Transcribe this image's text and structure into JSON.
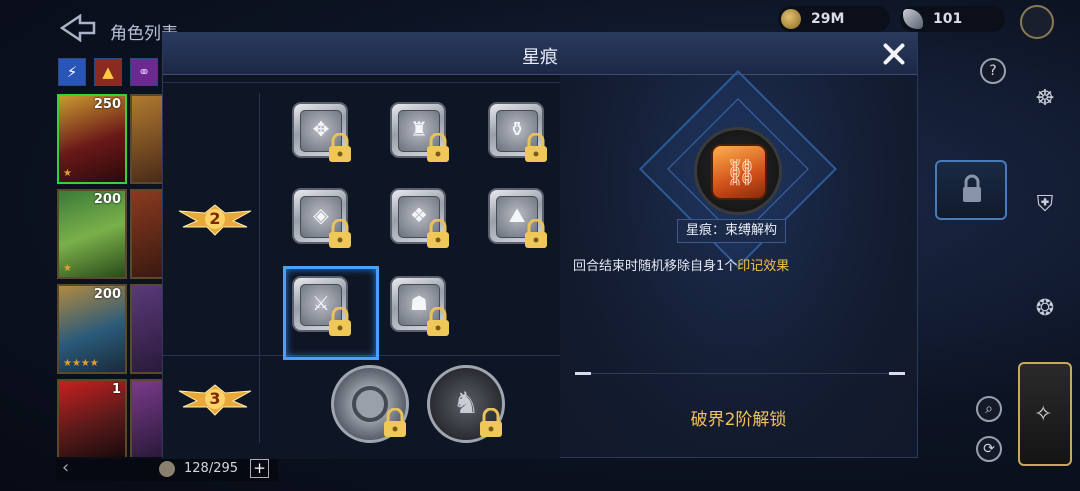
{
  "background": {
    "title": "角色列表",
    "currency": {
      "gold": "29M",
      "gems": "101"
    },
    "hero_levels": [
      "250",
      "200",
      "200",
      "1"
    ],
    "roster_count": "128/295",
    "rail_badge": "2"
  },
  "modal": {
    "title": "星痕",
    "tiers": [
      {
        "label": "2",
        "runes": [
          "✥",
          "♜",
          "⚱",
          "◈",
          "❖",
          "⛰",
          "⚔",
          "☗"
        ]
      },
      {
        "label": "3",
        "runes": [
          "◎",
          "♞"
        ]
      }
    ],
    "detail": {
      "name": "星痕：束缚解构",
      "desc_prefix": "回合结束时随机移除自身1个",
      "desc_highlight": "印记效果",
      "unlock_requirement": "破界2阶解锁"
    }
  },
  "colors": {
    "accent_blue": "#4aa0ff",
    "highlight_gold": "#f2c04a",
    "selected_rune": "#d0501a"
  }
}
